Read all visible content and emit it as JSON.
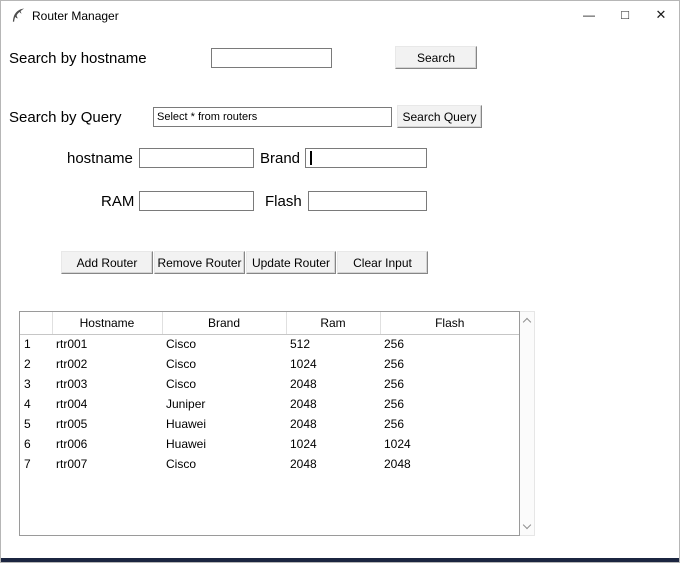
{
  "window": {
    "title": "Router Manager",
    "controls": {
      "minimize": "—",
      "maximize": "□",
      "close": "✕"
    }
  },
  "search_hostname": {
    "label": "Search by hostname",
    "value": "",
    "button": "Search"
  },
  "search_query": {
    "label": "Search by Query",
    "value": "Select * from routers",
    "button": "Search Query"
  },
  "form": {
    "hostname": {
      "label": "hostname",
      "value": ""
    },
    "brand": {
      "label": "Brand",
      "value": ""
    },
    "ram": {
      "label": "RAM",
      "value": ""
    },
    "flash": {
      "label": "Flash",
      "value": ""
    }
  },
  "actions": {
    "add": "Add Router",
    "remove": "Remove Router",
    "update": "Update Router",
    "clear": "Clear Input"
  },
  "table": {
    "headers": [
      "",
      "Hostname",
      "Brand",
      "Ram",
      "Flash"
    ],
    "rows": [
      [
        "1",
        "rtr001",
        "Cisco",
        "512",
        "256"
      ],
      [
        "2",
        "rtr002",
        "Cisco",
        "1024",
        "256"
      ],
      [
        "3",
        "rtr003",
        "Cisco",
        "2048",
        "256"
      ],
      [
        "4",
        "rtr004",
        "Juniper",
        "2048",
        "256"
      ],
      [
        "5",
        "rtr005",
        "Huawei",
        "2048",
        "256"
      ],
      [
        "6",
        "rtr006",
        "Huawei",
        "1024",
        "1024"
      ],
      [
        "7",
        "rtr007",
        "Cisco",
        "2048",
        "2048"
      ]
    ]
  },
  "colors": {
    "window_border": "#b6b6b6",
    "taskbar_edge": "#1b2540",
    "entry_border": "#7a7a7a",
    "button_face": "#f2f2f2"
  }
}
